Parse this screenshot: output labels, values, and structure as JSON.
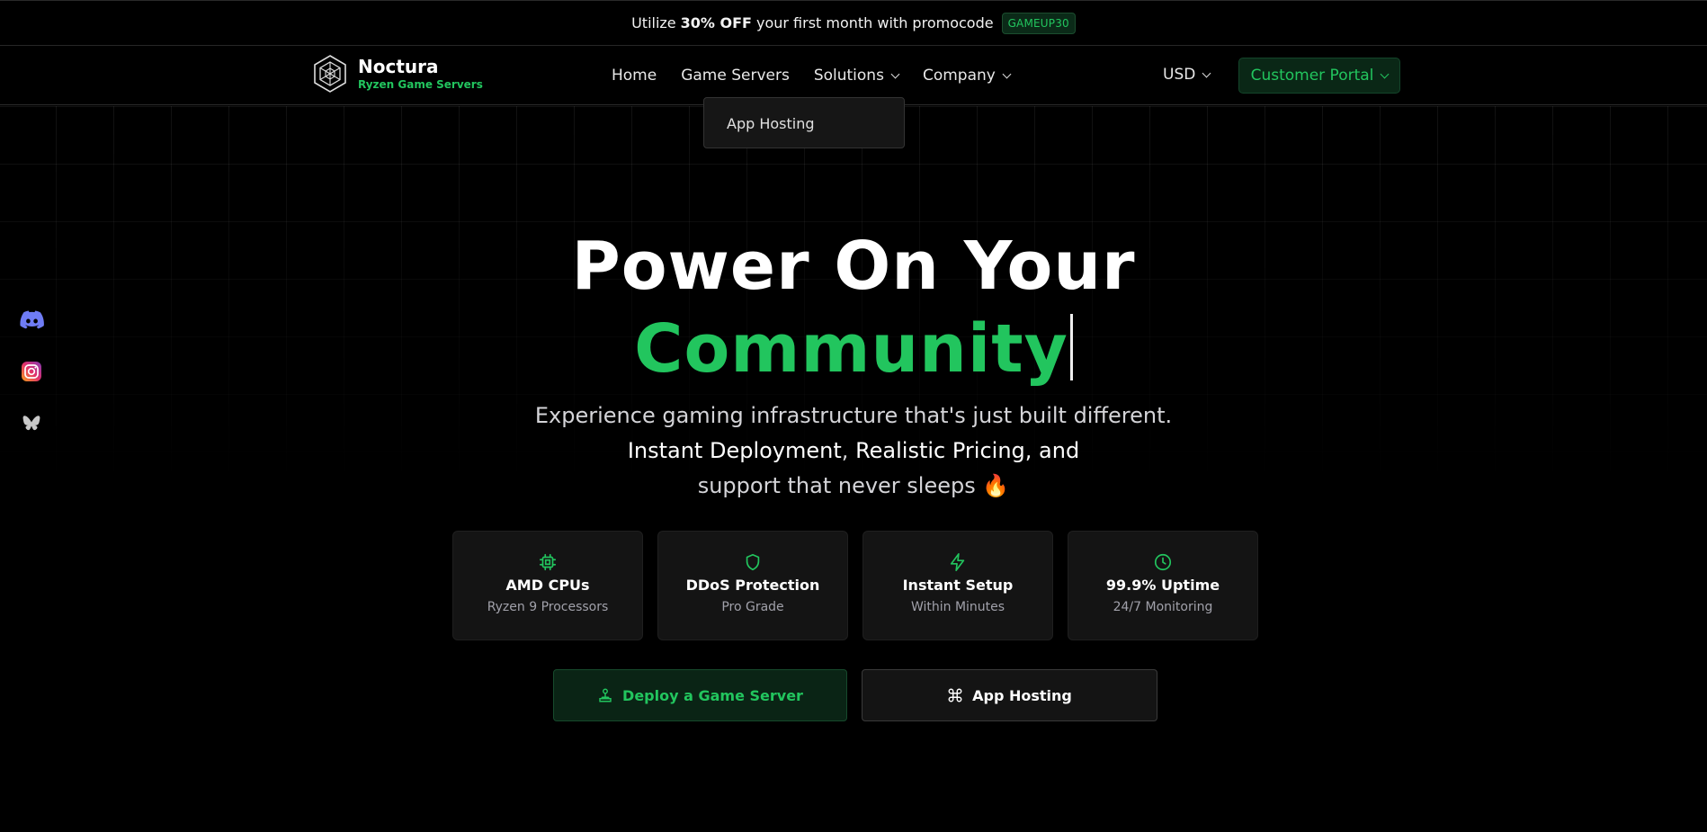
{
  "promo": {
    "prefix": "Utilize",
    "discount": "30% OFF",
    "suffix": "your first month with promocode",
    "code": "GAMEUP30"
  },
  "brand": {
    "name": "Noctura",
    "tagline": "Ryzen Game Servers"
  },
  "nav": {
    "items": [
      {
        "label": "Home"
      },
      {
        "label": "Game Servers"
      },
      {
        "label": "Solutions"
      },
      {
        "label": "Company"
      }
    ],
    "currency": "USD",
    "portal": "Customer Portal"
  },
  "solutions_dropdown": {
    "items": [
      {
        "label": "App Hosting"
      }
    ]
  },
  "socials": [
    {
      "icon": "discord-icon"
    },
    {
      "icon": "instagram-icon"
    },
    {
      "icon": "bluesky-icon"
    }
  ],
  "hero": {
    "title_line1": "Power On Your",
    "title_line2": "Community",
    "subtitle_line1": "Experience gaming infrastructure that's just built different.",
    "subtitle_strong1": "Instant Deployment",
    "subtitle_sep": ",",
    "subtitle_strong2": "Realistic Pricing, and",
    "subtitle_line3": "support that never sleeps",
    "emoji": "🔥"
  },
  "features": [
    {
      "icon": "cpu-icon",
      "title": "AMD CPUs",
      "subtitle": "Ryzen 9 Processors"
    },
    {
      "icon": "shield-icon",
      "title": "DDoS Protection",
      "subtitle": "Pro Grade"
    },
    {
      "icon": "lightning-icon",
      "title": "Instant Setup",
      "subtitle": "Within Minutes"
    },
    {
      "icon": "clock-icon",
      "title": "99.9% Uptime",
      "subtitle": "24/7 Monitoring"
    }
  ],
  "cta": {
    "deploy": "Deploy a Game Server",
    "app_hosting": "App Hosting"
  },
  "colors": {
    "accent": "#22c55e",
    "background": "#000000",
    "card": "#141414"
  }
}
